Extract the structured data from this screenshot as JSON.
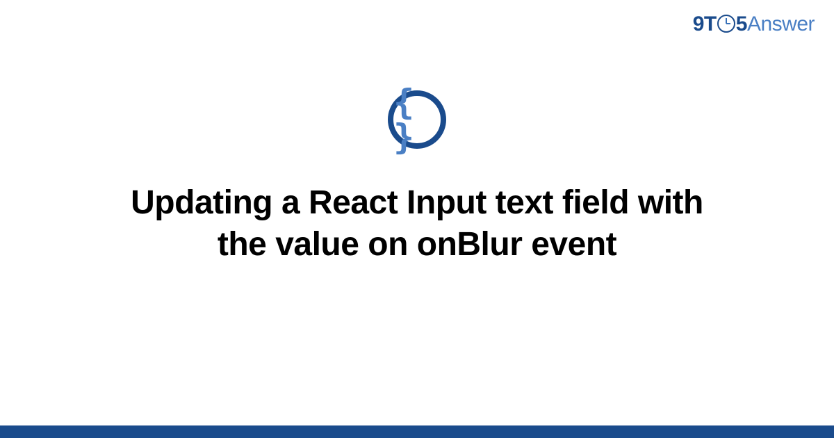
{
  "header": {
    "logo_prefix": "9T",
    "logo_number": "5",
    "logo_suffix": "Answer"
  },
  "icon": {
    "symbol": "{ }",
    "name": "code-braces"
  },
  "title": "Updating a React Input text field with the value on onBlur event",
  "colors": {
    "brand_dark": "#1a4b8c",
    "brand_light": "#4a7fc4",
    "text": "#000000",
    "background": "#ffffff"
  }
}
